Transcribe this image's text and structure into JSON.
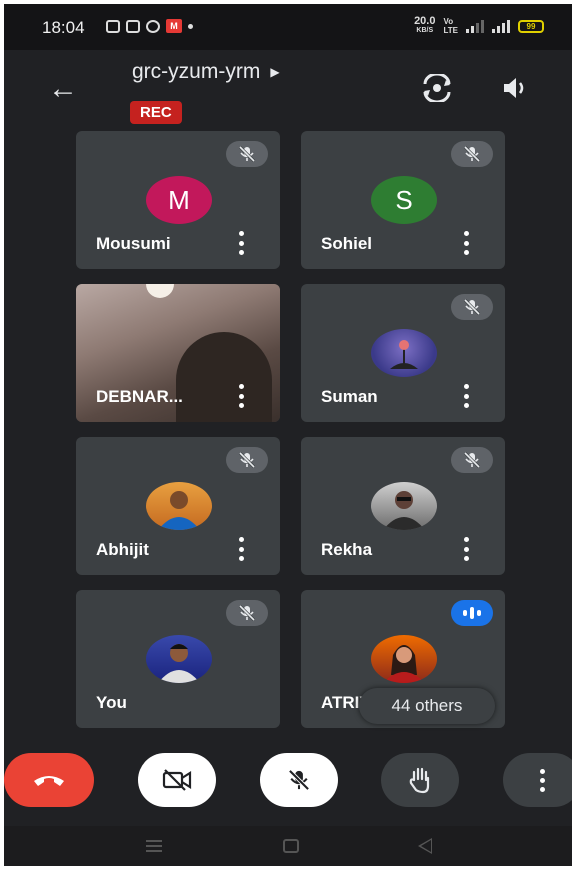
{
  "status_bar": {
    "time": "18:04",
    "speed_value": "20.0",
    "speed_unit": "KB/S",
    "battery": "99"
  },
  "header": {
    "meeting_code": "grc-yzum-yrm",
    "rec_label": "REC"
  },
  "participants": [
    {
      "name": "Mousumi",
      "initial": "M",
      "avatar_color": "#c2185b",
      "mic": "muted"
    },
    {
      "name": "Sohiel",
      "initial": "S",
      "avatar_color": "#2e7d32",
      "mic": "muted"
    },
    {
      "name": "DEBNAR...",
      "mic": "on",
      "video": true
    },
    {
      "name": "Suman",
      "mic": "muted"
    },
    {
      "name": "Abhijit",
      "mic": "muted"
    },
    {
      "name": "Rekha",
      "mic": "muted"
    },
    {
      "name": "You",
      "mic": "muted"
    },
    {
      "name": "ATRIY",
      "mic": "speaking"
    }
  ],
  "others_label": "44 others",
  "colors": {
    "end_call": "#ea4335",
    "rec": "#c5221f",
    "speaking": "#1a73e8"
  }
}
